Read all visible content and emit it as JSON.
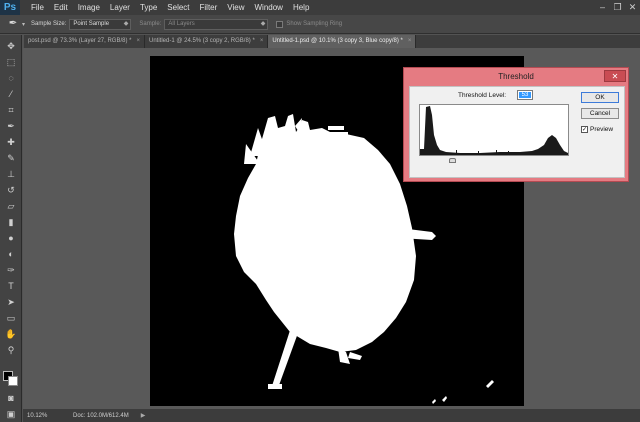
{
  "app": {
    "logo": "Ps"
  },
  "menubar": {
    "items": [
      "File",
      "Edit",
      "Image",
      "Layer",
      "Type",
      "Select",
      "Filter",
      "View",
      "Window",
      "Help"
    ]
  },
  "window_controls": {
    "minimize": "–",
    "restore": "❐",
    "close": "✕"
  },
  "options": {
    "sample_size_label": "Sample Size:",
    "sample_size_value": "Point Sample",
    "sample_label": "Sample:",
    "sample_value": "All Layers",
    "show_ring_label": "Show Sampling Ring"
  },
  "tabs": [
    {
      "label": "post.psd @ 73.3% (Layer 27, RGB/8) *",
      "close": "×",
      "active": false
    },
    {
      "label": "Untitled-1 @ 24.5% (3 copy 2, RGB/8) *",
      "close": "×",
      "active": false
    },
    {
      "label": "Untitled-1.psd @ 10.1% (3 copy 3, Blue copy/8) *",
      "close": "×",
      "active": true
    }
  ],
  "statusbar": {
    "zoom": "10.12%",
    "doc": "Doc: 102.0M/612.4M",
    "arrow": "▶"
  },
  "dialog": {
    "title": "Threshold",
    "close": "✕",
    "level_label": "Threshold Level:",
    "level_value": "53",
    "ok": "OK",
    "cancel": "Cancel",
    "preview_label": "Preview",
    "preview_checked": true
  },
  "colors": {
    "dialog_frame": "#e57b82",
    "dialog_close": "#c94c53",
    "selection": "#3399ff"
  }
}
